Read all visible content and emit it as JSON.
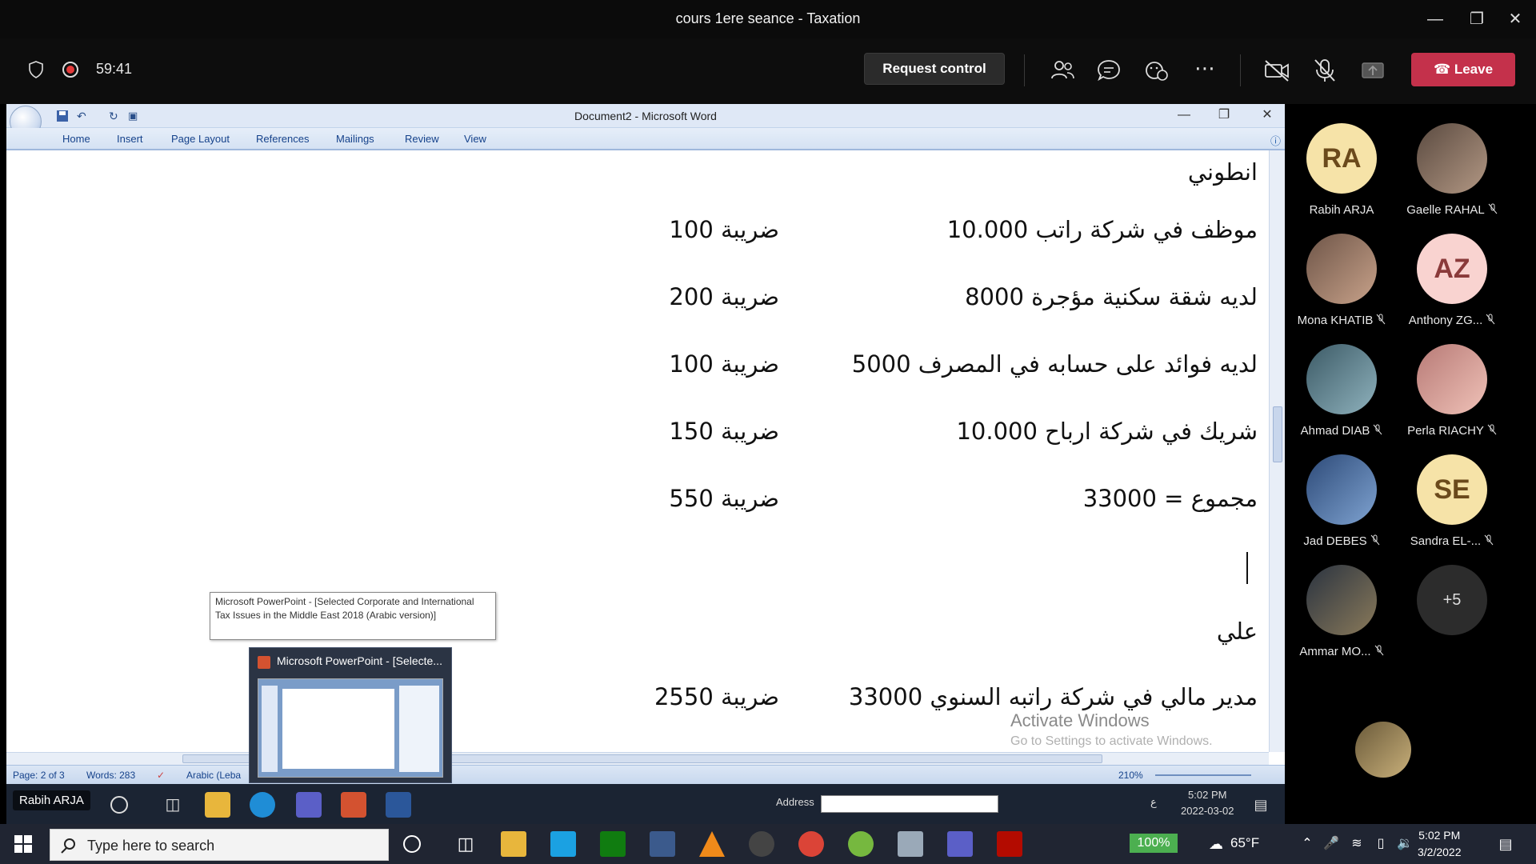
{
  "window": {
    "title": "cours 1ere seance - Taxation"
  },
  "meeting": {
    "timer": "59:41",
    "request_control": "Request control",
    "leave": "Leave"
  },
  "word": {
    "title": "Document2 - Microsoft Word",
    "tabs": [
      "Home",
      "Insert",
      "Page Layout",
      "References",
      "Mailings",
      "Review",
      "View"
    ],
    "lines": [
      {
        "text": "انطوني"
      },
      {
        "text": "موظف في شركة راتب 10.000",
        "tax": "ضريبة 100"
      },
      {
        "text": "لديه شقة سكنية مؤجرة 8000",
        "tax": "ضريبة 200"
      },
      {
        "text": "لديه فوائد على حسابه في المصرف 5000",
        "tax": "ضريبة 100"
      },
      {
        "text": "شريك في شركة ارباح 10.000",
        "tax": "ضريبة 150"
      },
      {
        "text": "مجموع = 33000",
        "tax": "ضريبة 550"
      },
      {
        "text": "علي"
      },
      {
        "text": "مدير مالي في شركة راتبه السنوي 33000",
        "tax": "ضريبة 2550"
      }
    ],
    "watermark": "Activate Windows",
    "watermark_sub": "Go to Settings to activate Windows.",
    "status": {
      "page": "Page: 2 of 3",
      "words": "Words: 283",
      "language": "Arabic (Leba",
      "zoom": "210%"
    }
  },
  "popup": {
    "tooltip": "Microsoft PowerPoint - [Selected Corporate and International Tax Issues in the Middle East 2018 (Arabic version)]",
    "thumb_title": "Microsoft PowerPoint - [Selecte..."
  },
  "inner_taskbar": {
    "presenter": "Rabih ARJA",
    "address_label": "Address",
    "time": "5:02 PM",
    "date": "2022-03-02",
    "lang": "ع"
  },
  "participants": [
    {
      "initials": "RA",
      "name": "Rabih ARJA",
      "muted": false,
      "color": "#f6e3a8"
    },
    {
      "initials": "",
      "name": "Gaelle RAHAL",
      "muted": true,
      "color": "#8a7060"
    },
    {
      "initials": "",
      "name": "Mona KHATIB",
      "muted": true,
      "color": "#9c7a66"
    },
    {
      "initials": "AZ",
      "name": "Anthony ZG...",
      "muted": true,
      "color": "#f9d3d0"
    },
    {
      "initials": "",
      "name": "Ahmad DIAB",
      "muted": true,
      "color": "#5f7f8c"
    },
    {
      "initials": "",
      "name": "Perla RIACHY",
      "muted": true,
      "color": "#d8a09c"
    },
    {
      "initials": "",
      "name": "Jad DEBES",
      "muted": true,
      "color": "#4f6d94"
    },
    {
      "initials": "SE",
      "name": "Sandra EL-...",
      "muted": true,
      "color": "#f6e3a8"
    },
    {
      "initials": "",
      "name": "Ammar MO...",
      "muted": true,
      "color": "#3d4a5c"
    },
    {
      "initials": "+5",
      "name": "",
      "muted": false,
      "color": "#2c2c2c"
    }
  ],
  "taskbar": {
    "search_placeholder": "Type here to search",
    "battery": "100%",
    "temperature": "65°F",
    "time": "5:02 PM",
    "date": "3/2/2022"
  }
}
